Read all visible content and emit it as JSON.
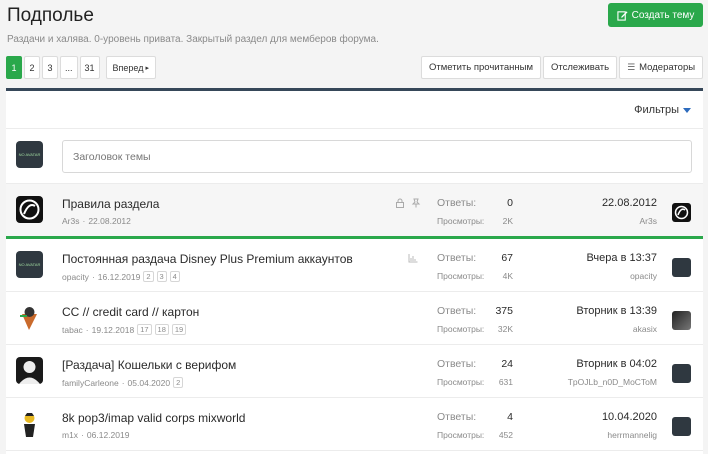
{
  "forum": {
    "title": "Подполье",
    "description": "Раздачи и халява. 0-уровень привата. Закрытый раздел для мемберов форума."
  },
  "create_button": {
    "label": "Создать тему",
    "icon": "edit-icon"
  },
  "pagination": {
    "pages": [
      "1",
      "2",
      "3",
      "...",
      "31"
    ],
    "active": "1",
    "next_label": "Вперед"
  },
  "actions": {
    "mark_read": "Отметить прочитанным",
    "watch": "Отслеживать",
    "moderators": "Модераторы"
  },
  "filters_label": "Фильтры",
  "new_thread": {
    "placeholder": "Заголовок темы",
    "avatar_text": "NO AVATAR"
  },
  "stats_labels": {
    "replies": "Ответы:",
    "views": "Просмотры:"
  },
  "threads": [
    {
      "title": "Правила раздела",
      "author": "Ar3s",
      "date": "22.08.2012",
      "pages": [],
      "replies": "0",
      "views": "2K",
      "last_date": "22.08.2012",
      "last_user": "Ar3s",
      "status_icons": [
        "lock-icon",
        "pin-icon"
      ]
    },
    {
      "title": "Постоянная раздача Disney Plus Premium аккаунтов",
      "author": "opacity",
      "date": "16.12.2019",
      "pages": [
        "2",
        "3",
        "4"
      ],
      "replies": "67",
      "views": "4K",
      "last_date": "Вчера в 13:37",
      "last_user": "opacity",
      "status_icons": [
        "chart-icon"
      ]
    },
    {
      "title": "CC // credit card // картон",
      "author": "tabac",
      "date": "19.12.2018",
      "pages": [
        "17",
        "18",
        "19"
      ],
      "replies": "375",
      "views": "32K",
      "last_date": "Вторник в 13:39",
      "last_user": "akasix",
      "status_icons": []
    },
    {
      "title": "[Раздача] Кошельки с верифом",
      "author": "familyCarleone",
      "date": "05.04.2020",
      "pages": [
        "2"
      ],
      "replies": "24",
      "views": "631",
      "last_date": "Вторник в 04:02",
      "last_user": "TpOJLb_n0D_MoCToM",
      "status_icons": []
    },
    {
      "title": "8k pop3/imap valid corps mixworld",
      "author": "m1x",
      "date": "06.12.2019",
      "pages": [],
      "replies": "4",
      "views": "452",
      "last_date": "10.04.2020",
      "last_user": "herrmannelig",
      "status_icons": []
    }
  ],
  "colors": {
    "accent": "#2aa84b",
    "panel_top": "#364759",
    "link": "#2d6bbd"
  }
}
